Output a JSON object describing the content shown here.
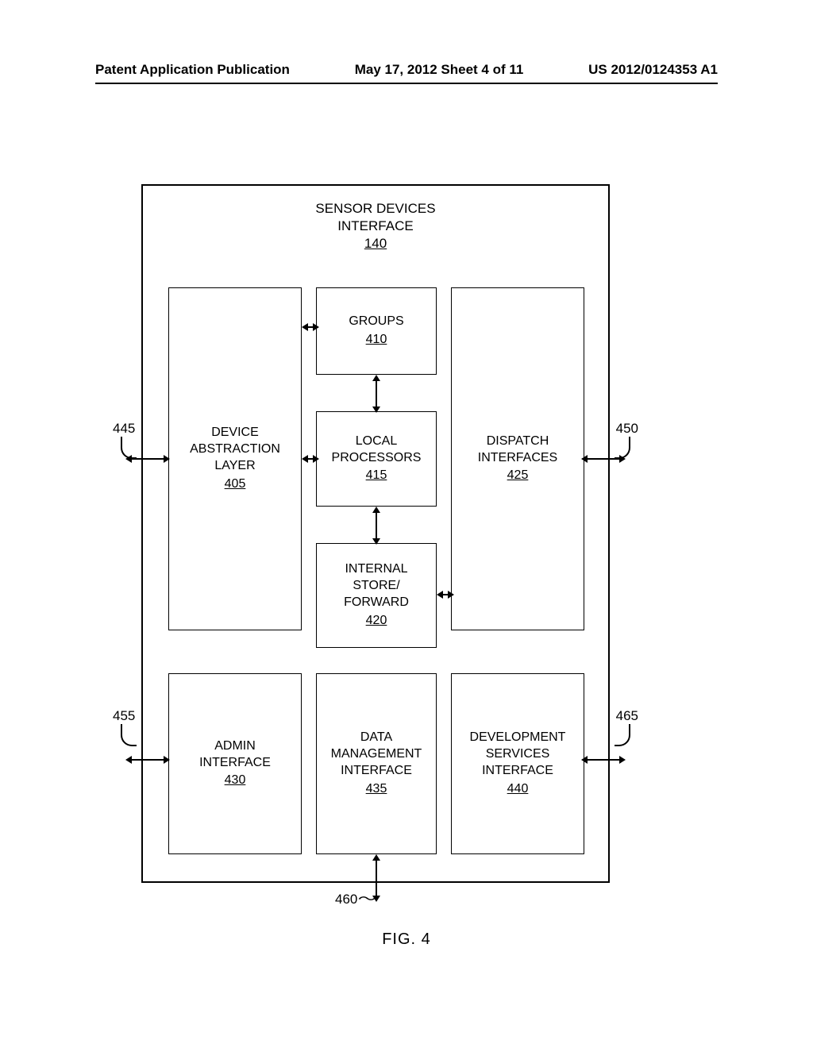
{
  "header": {
    "left": "Patent Application Publication",
    "center": "May 17, 2012  Sheet 4 of 11",
    "right": "US 2012/0124353 A1"
  },
  "figure": {
    "caption": "FIG. 4",
    "title": {
      "line1": "SENSOR DEVICES",
      "line2": "INTERFACE",
      "num": "140"
    },
    "blocks": {
      "dev_abs": {
        "l1": "DEVICE",
        "l2": "ABSTRACTION",
        "l3": "LAYER",
        "num": "405"
      },
      "groups": {
        "l1": "GROUPS",
        "num": "410"
      },
      "local": {
        "l1": "LOCAL",
        "l2": "PROCESSORS",
        "num": "415"
      },
      "internal": {
        "l1": "INTERNAL",
        "l2": "STORE/",
        "l3": "FORWARD",
        "num": "420"
      },
      "dispatch": {
        "l1": "DISPATCH",
        "l2": "INTERFACES",
        "num": "425"
      },
      "admin": {
        "l1": "ADMIN",
        "l2": "INTERFACE",
        "num": "430"
      },
      "datamgmt": {
        "l1": "DATA",
        "l2": "MANAGEMENT",
        "l3": "INTERFACE",
        "num": "435"
      },
      "devsvc": {
        "l1": "DEVELOPMENT",
        "l2": "SERVICES",
        "l3": "INTERFACE",
        "num": "440"
      }
    },
    "refs": {
      "r445": "445",
      "r450": "450",
      "r455": "455",
      "r460": "460",
      "r465": "465"
    }
  }
}
